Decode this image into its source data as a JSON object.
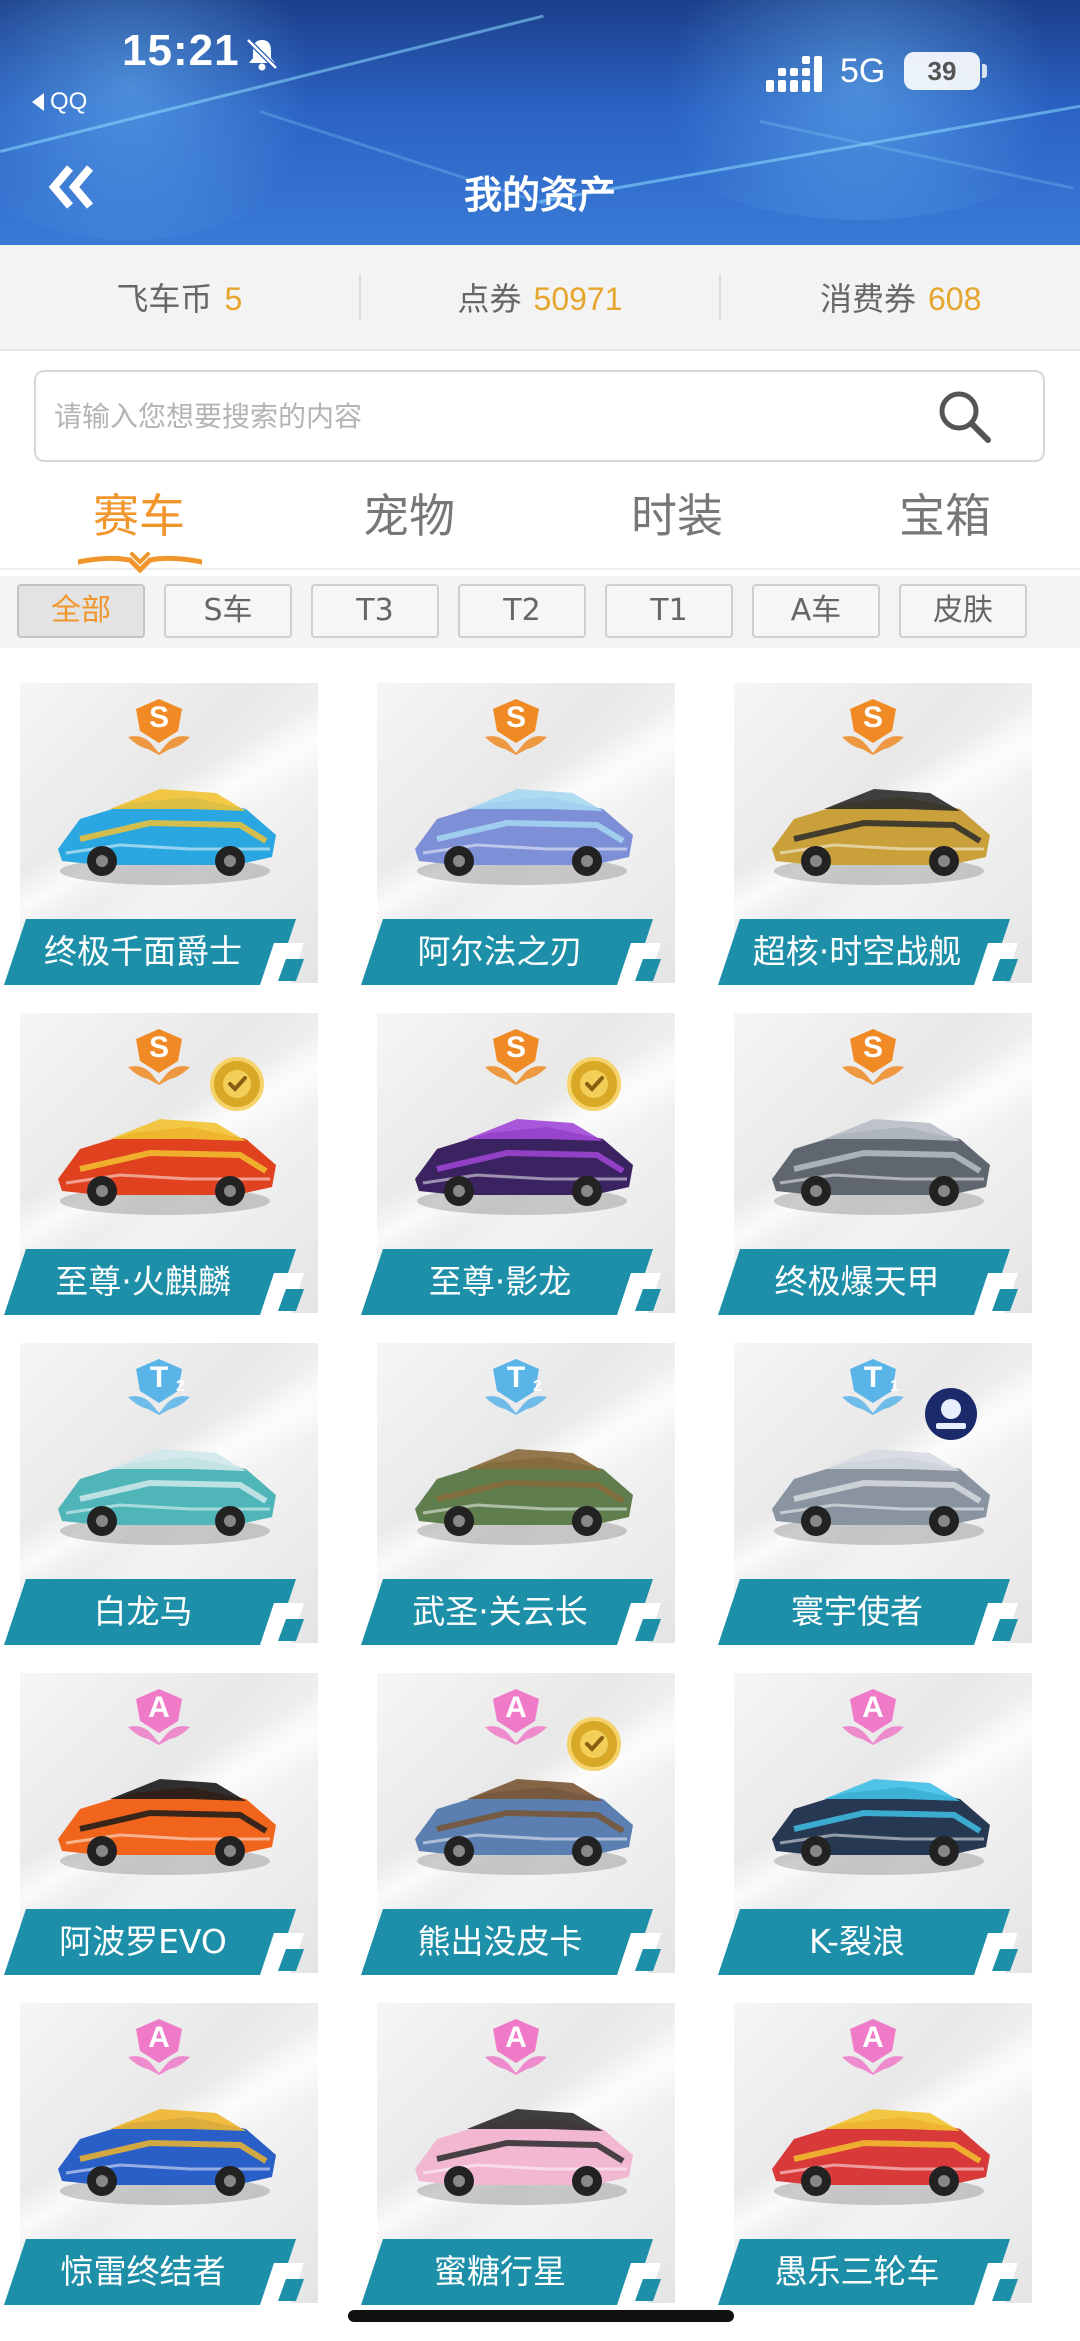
{
  "status_bar": {
    "time": "15:21",
    "back_app": "QQ",
    "network": "5G",
    "battery": "39"
  },
  "header": {
    "title": "我的资产"
  },
  "currencies": [
    {
      "label": "飞车币",
      "value": "5"
    },
    {
      "label": "点券",
      "value": "50971"
    },
    {
      "label": "消费券",
      "value": "608"
    }
  ],
  "search": {
    "placeholder": "请输入您想要搜索的内容"
  },
  "category_tabs": [
    {
      "label": "赛车",
      "active": true
    },
    {
      "label": "宠物",
      "active": false
    },
    {
      "label": "时装",
      "active": false
    },
    {
      "label": "宝箱",
      "active": false
    }
  ],
  "filters": [
    {
      "label": "全部",
      "active": true
    },
    {
      "label": "S车",
      "active": false
    },
    {
      "label": "T3",
      "active": false
    },
    {
      "label": "T2",
      "active": false
    },
    {
      "label": "T1",
      "active": false
    },
    {
      "label": "A车",
      "active": false
    },
    {
      "label": "皮肤",
      "active": false
    }
  ],
  "cars": [
    {
      "name": "终极千面爵士",
      "rank": "S",
      "color": "#2aa7e0",
      "accent": "#f1c232"
    },
    {
      "name": "阿尔法之刃",
      "rank": "S",
      "color": "#7d8fd6",
      "accent": "#a6d8f2"
    },
    {
      "name": "超核·时空战舰",
      "rank": "S",
      "color": "#c9a03a",
      "accent": "#2b2b2b"
    },
    {
      "name": "至尊·火麒麟",
      "rank": "S",
      "color": "#e0411f",
      "accent": "#f2c230",
      "extra_badge": true
    },
    {
      "name": "至尊·影龙",
      "rank": "S",
      "color": "#3b2361",
      "accent": "#a247d8",
      "extra_badge": true
    },
    {
      "name": "终极爆天甲",
      "rank": "S",
      "color": "#5f6670",
      "accent": "#b8bec6"
    },
    {
      "name": "白龙马",
      "rank": "T2",
      "color": "#4fb5b8",
      "accent": "#cfe8ea"
    },
    {
      "name": "武圣·关云长",
      "rank": "T2",
      "color": "#5f7d4d",
      "accent": "#8a6a3b"
    },
    {
      "name": "寰宇使者",
      "rank": "T1",
      "color": "#8a93a0",
      "accent": "#d7dce2",
      "logo_badge": true
    },
    {
      "name": "阿波罗EVO",
      "rank": "A",
      "color": "#f0641c",
      "accent": "#1a1a1a"
    },
    {
      "name": "熊出没皮卡",
      "rank": "A",
      "color": "#5a7fb0",
      "accent": "#7a5534",
      "extra_badge": true
    },
    {
      "name": "K-裂浪",
      "rank": "A",
      "color": "#273852",
      "accent": "#3fc0e6"
    },
    {
      "name": "惊雷终结者",
      "rank": "A",
      "color": "#2a5fc8",
      "accent": "#f0b52c"
    },
    {
      "name": "蜜糖行星",
      "rank": "A",
      "color": "#f2b8d2",
      "accent": "#2a2a2a"
    },
    {
      "name": "愚乐三轮车",
      "rank": "A",
      "color": "#d83a3a",
      "accent": "#f2c230"
    }
  ],
  "colors": {
    "accent_orange": "#f0962c",
    "currency_value": "#e6a52c",
    "plate_teal": "#1e8fa8",
    "rank_S": "#f08a24",
    "rank_T": "#5ab4e8",
    "rank_A": "#ee7ac8"
  },
  "icons": {
    "back": "double-chevron-left-icon",
    "search": "magnifier-icon",
    "mute": "bell-slash-icon",
    "signal": "signal-bars-icon"
  }
}
